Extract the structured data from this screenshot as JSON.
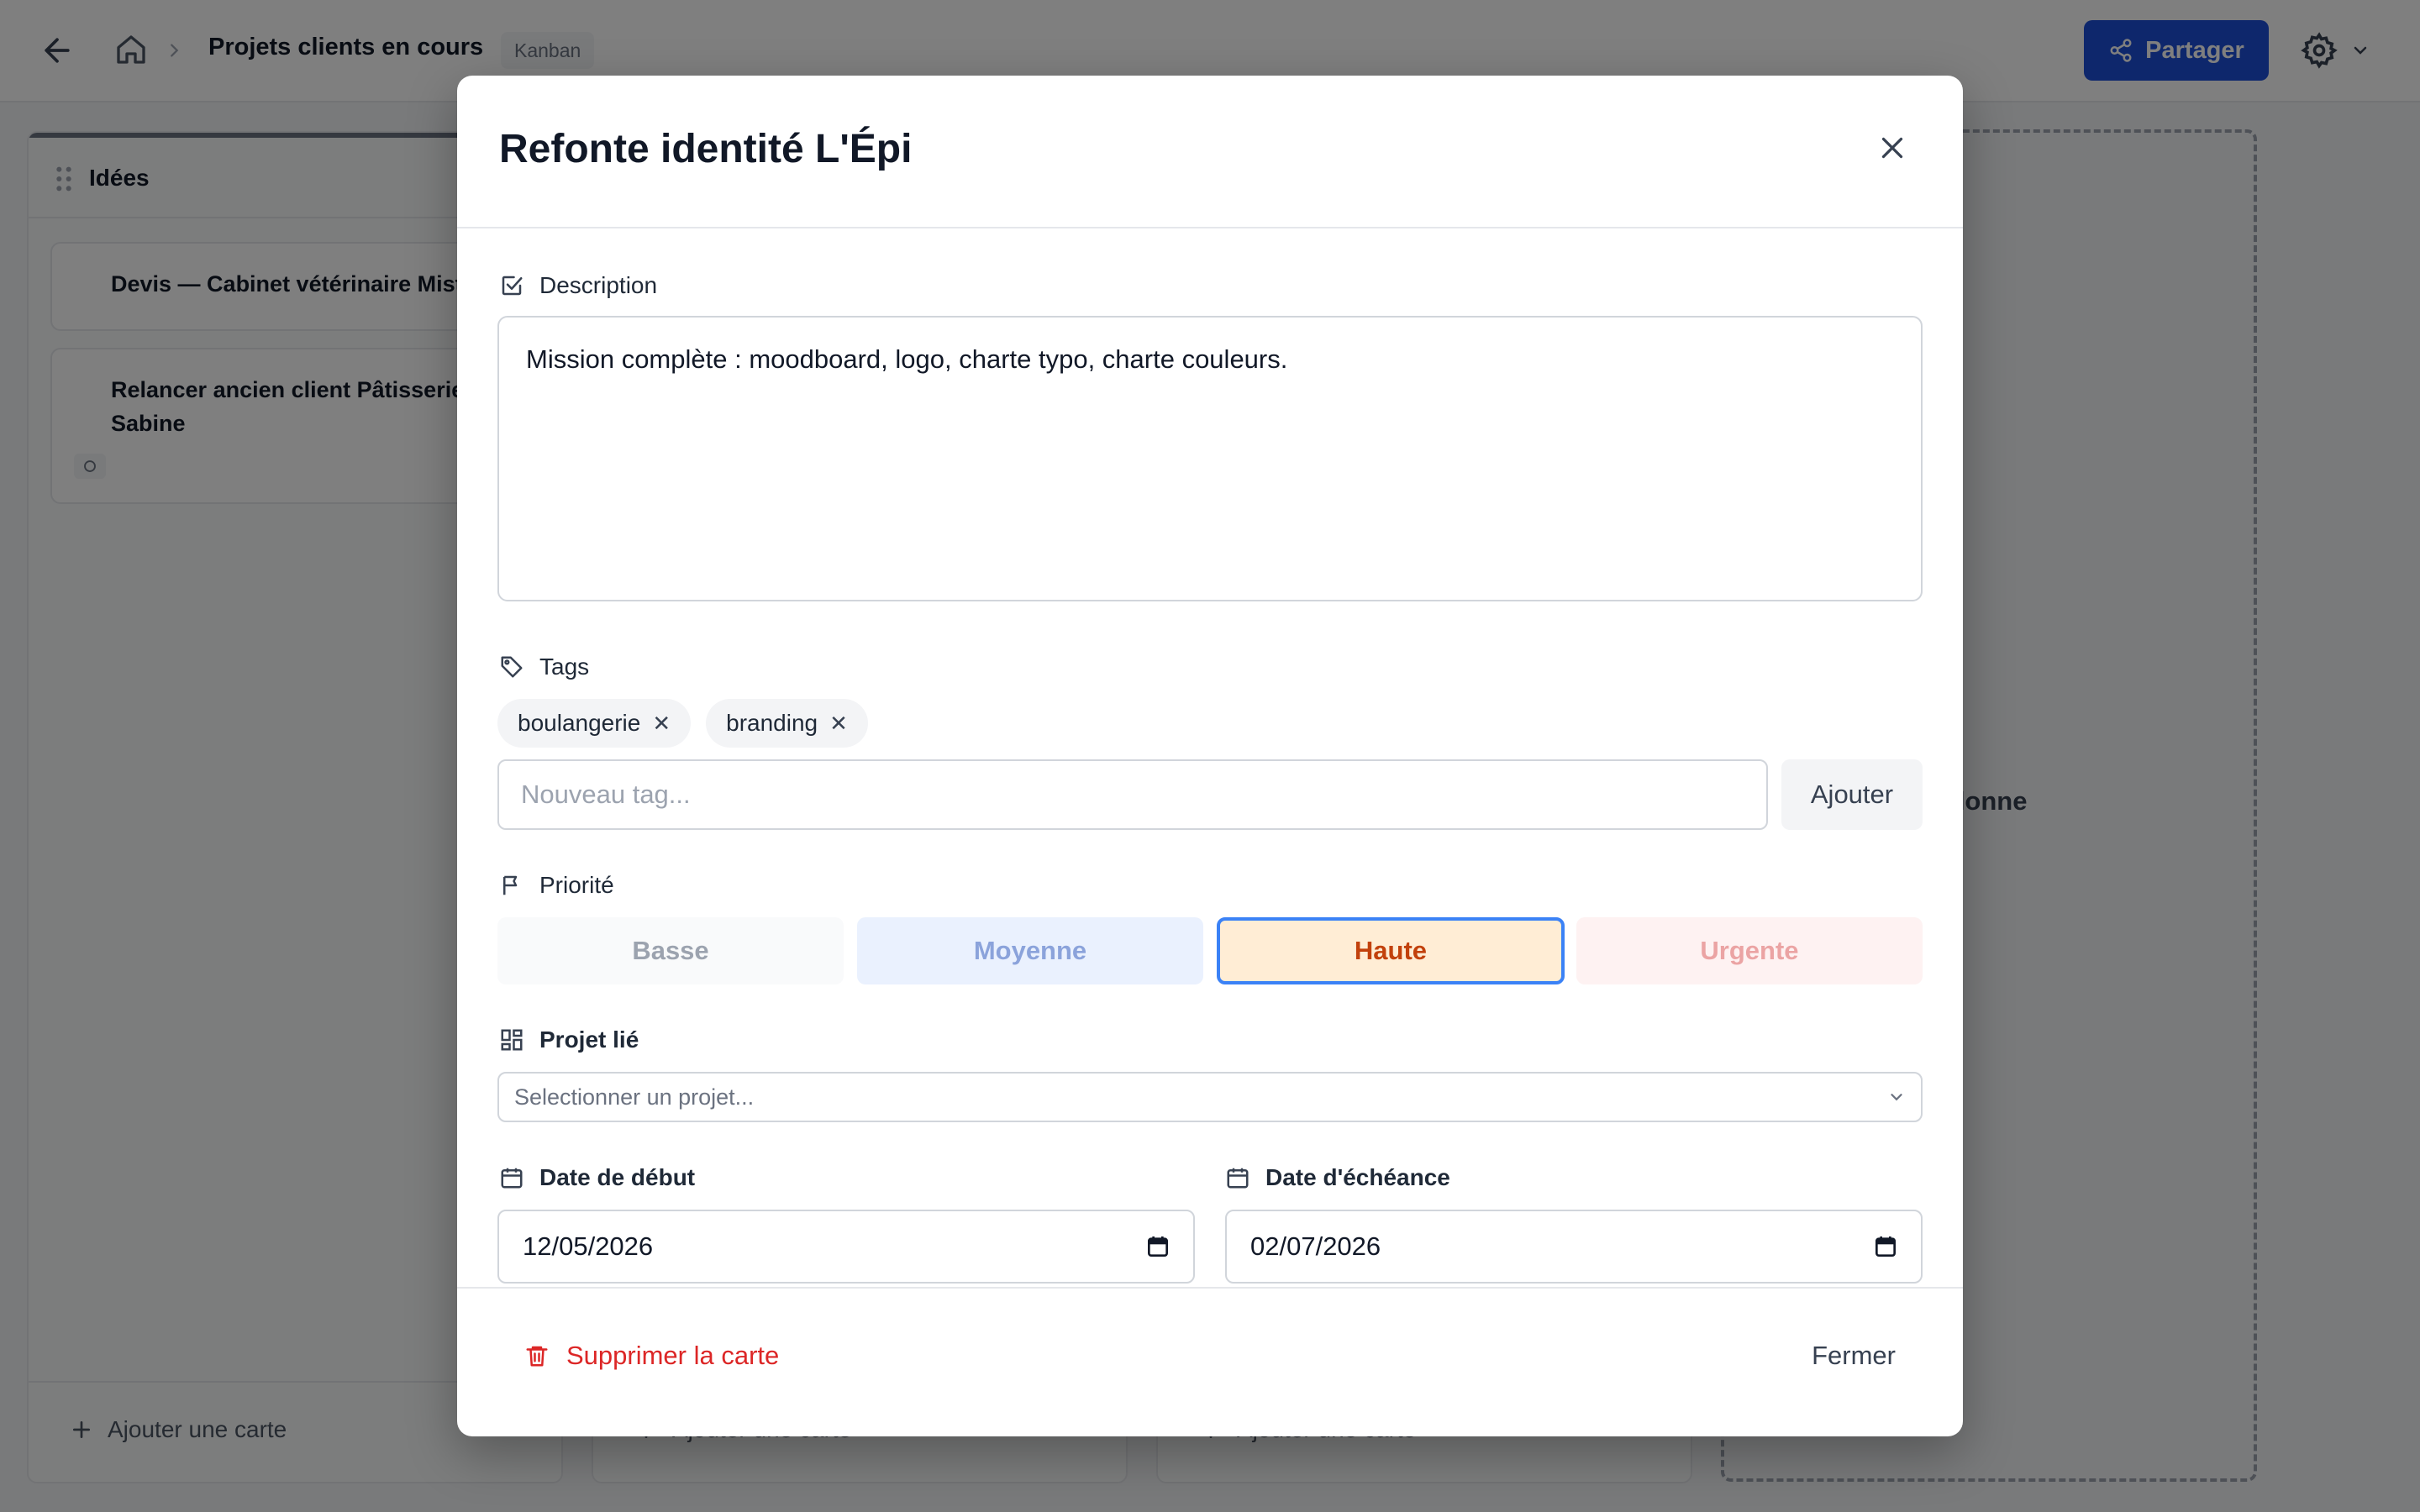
{
  "header": {
    "title": "Projets clients en cours",
    "view_badge": "Kanban",
    "share_label": "Partager"
  },
  "board": {
    "columns": [
      {
        "name": "Idées",
        "cards": [
          {
            "title": "Devis — Cabinet vétérinaire Mist"
          },
          {
            "title": "Relancer ancien client Pâtisserie Sabine"
          }
        ],
        "add_card_label": "Ajouter une carte"
      },
      {
        "name": "",
        "cards": [],
        "add_card_label": "Ajouter une carte"
      },
      {
        "name": "",
        "cards": [],
        "add_card_label": "Ajouter une carte"
      }
    ],
    "add_column_label": "er une colonne"
  },
  "modal": {
    "title": "Refonte identité L'Épi",
    "description_label": "Description",
    "description_value": "Mission complète : moodboard, logo, charte typo, charte couleurs.",
    "tags_label": "Tags",
    "tags": [
      {
        "label": "boulangerie"
      },
      {
        "label": "branding"
      }
    ],
    "tag_remove_glyph": "✕",
    "new_tag_placeholder": "Nouveau tag...",
    "add_tag_label": "Ajouter",
    "priority_label": "Priorité",
    "priorities": {
      "low": "Basse",
      "medium": "Moyenne",
      "high": "Haute",
      "urgent": "Urgente"
    },
    "selected_priority": "high",
    "project_label": "Projet lié",
    "project_placeholder": "Selectionner un projet...",
    "start_date_label": "Date de début",
    "start_date": "12/05/2026",
    "due_date_label": "Date d'échéance",
    "due_date": "02/07/2026",
    "delete_label": "Supprimer la carte",
    "close_label": "Fermer"
  },
  "colors": {
    "primary": "#1d4ed8",
    "danger": "#dc2626",
    "priority_high_bg": "#ffedd5",
    "priority_high_text": "#c2410c",
    "focus_ring": "#3b82f6"
  }
}
